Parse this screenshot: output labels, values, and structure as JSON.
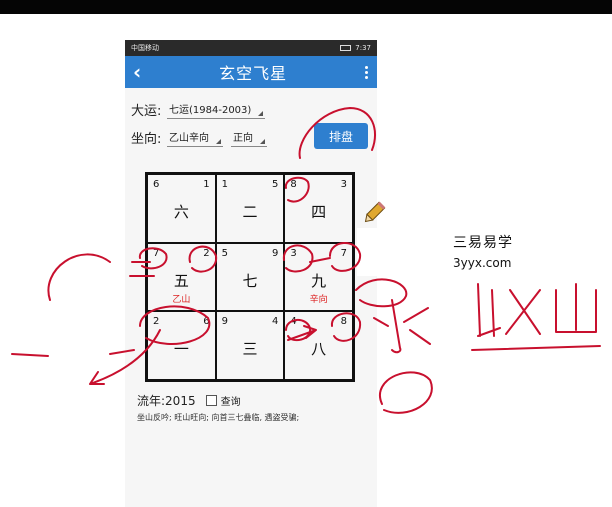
{
  "status_bar": {
    "carrier": "中国移动",
    "time": "7:37"
  },
  "app_bar": {
    "title": "玄空飞星"
  },
  "form": {
    "dayun_label": "大运:",
    "dayun_value": "七运(1984-2003)",
    "zuoxiang_label": "坐向:",
    "zuoxiang_value": "乙山辛向",
    "direction_value": "正向",
    "paipan_button": "排盘"
  },
  "grid": {
    "cells": [
      {
        "tl": "6",
        "tr": "1",
        "mid": "六",
        "sub": ""
      },
      {
        "tl": "1",
        "tr": "5",
        "mid": "二",
        "sub": ""
      },
      {
        "tl": "8",
        "tr": "3",
        "mid": "四",
        "sub": ""
      },
      {
        "tl": "7",
        "tr": "2",
        "mid": "五",
        "sub": "乙山"
      },
      {
        "tl": "5",
        "tr": "9",
        "mid": "七",
        "sub": ""
      },
      {
        "tl": "3",
        "tr": "7",
        "mid": "九",
        "sub": "辛向"
      },
      {
        "tl": "2",
        "tr": "6",
        "mid": "一",
        "sub": ""
      },
      {
        "tl": "9",
        "tr": "4",
        "mid": "三",
        "sub": ""
      },
      {
        "tl": "4",
        "tr": "8",
        "mid": "八",
        "sub": ""
      }
    ]
  },
  "liunian": {
    "label": "流年:",
    "year": "2015",
    "query_label": "查询"
  },
  "summary": "坐山反吟; 旺山旺向; 向首三七叠临, 遇盗受骗;",
  "watermark": {
    "line1": "三易易学",
    "line2": "3yyx.com"
  },
  "colors": {
    "app_bar": "#2e7fcf",
    "annotation_red": "#c8102e",
    "sub_red": "#d22222"
  }
}
